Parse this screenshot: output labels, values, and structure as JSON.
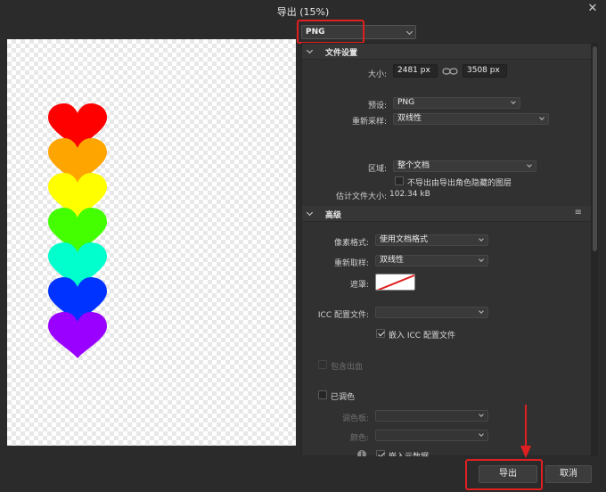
{
  "window": {
    "title": "导出 (15%)",
    "close_icon": "close-icon"
  },
  "format": {
    "selected": "PNG"
  },
  "preview": {
    "hearts": [
      "#ff0000",
      "#ffa500",
      "#ffff00",
      "#44ff00",
      "#00ffcc",
      "#0033ff",
      "#9900ff"
    ]
  },
  "file_settings": {
    "header": "文件设置",
    "size_label": "大小:",
    "width": "2481 px",
    "height": "3508 px",
    "preset_label": "预设:",
    "preset": "PNG",
    "resample_label": "重新采样:",
    "resample": "双线性",
    "area_label": "区域:",
    "area": "整个文档",
    "hidden_layers_option": "不导出由导出角色隐藏的图层",
    "estimate_label": "估计文件大小:",
    "estimate_value": "102.34 kB"
  },
  "advanced": {
    "header": "高级",
    "pixel_format_label": "像素格式:",
    "pixel_format": "使用文档格式",
    "resample_label": "重新取样:",
    "resample": "双线性",
    "matte_label": "遮罩:",
    "icc_label": "ICC 配置文件:",
    "icc_value": "",
    "embed_icc": "嵌入 ICC 配置文件",
    "include_bleed": "包含出血",
    "palettised": "已调色",
    "palette_label": "调色板:",
    "colors_label": "颜色:",
    "embed_metadata": "嵌入元数据"
  },
  "buttons": {
    "export": "导出",
    "cancel": "取消"
  },
  "colors": {
    "highlight": "#e02020",
    "panel_bg": "#313131"
  }
}
